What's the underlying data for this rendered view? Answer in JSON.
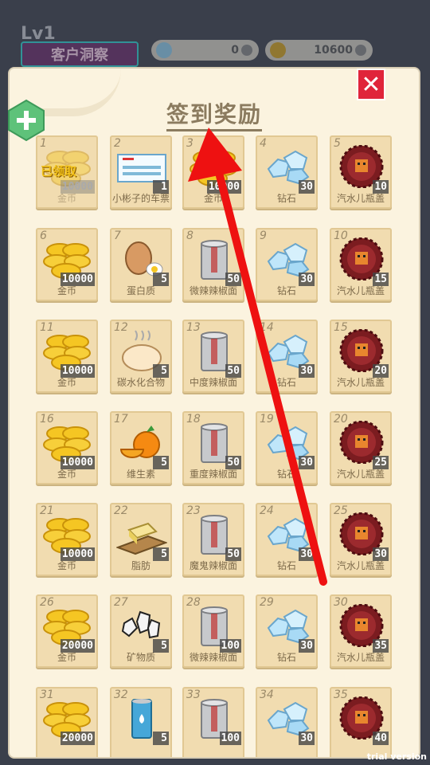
{
  "hud": {
    "level": "Lv1",
    "client_label": "客户洞察",
    "diamonds": "0",
    "coins": "10600"
  },
  "dialog": {
    "title": "签到奖励",
    "close_glyph": "✕"
  },
  "claimed_label": "已领取",
  "watermark": "trial version",
  "colors": {
    "panel": "#fbf3df",
    "cell": "#f1dcb0",
    "close": "#e0243a",
    "arrow": "#ee1111",
    "plus": "#5ec27a"
  },
  "rewards": [
    {
      "day": "1",
      "icon": "coin-icon",
      "qty": "10000",
      "name": "金币",
      "claimed": true
    },
    {
      "day": "2",
      "icon": "ticket-icon",
      "qty": "1",
      "name": "小彬子的车票"
    },
    {
      "day": "3",
      "icon": "coin-icon",
      "qty": "10000",
      "name": "金币"
    },
    {
      "day": "4",
      "icon": "diamond-icon",
      "qty": "30",
      "name": "钻石"
    },
    {
      "day": "5",
      "icon": "bottle-cap-icon",
      "qty": "10",
      "name": "汽水儿瓶盖"
    },
    {
      "day": "6",
      "icon": "coin-icon",
      "qty": "10000",
      "name": "金币"
    },
    {
      "day": "7",
      "icon": "egg-icon",
      "qty": "5",
      "name": "蛋白质"
    },
    {
      "day": "8",
      "icon": "noodle-can-icon",
      "qty": "50",
      "name": "微辣辣椒面"
    },
    {
      "day": "9",
      "icon": "diamond-icon",
      "qty": "30",
      "name": "钻石"
    },
    {
      "day": "10",
      "icon": "bottle-cap-icon",
      "qty": "15",
      "name": "汽水儿瓶盖"
    },
    {
      "day": "11",
      "icon": "coin-icon",
      "qty": "10000",
      "name": "金币"
    },
    {
      "day": "12",
      "icon": "bun-icon",
      "qty": "5",
      "name": "碳水化合物"
    },
    {
      "day": "13",
      "icon": "noodle-can-icon",
      "qty": "50",
      "name": "中度辣椒面"
    },
    {
      "day": "14",
      "icon": "diamond-icon",
      "qty": "30",
      "name": "钻石"
    },
    {
      "day": "15",
      "icon": "bottle-cap-icon",
      "qty": "20",
      "name": "汽水儿瓶盖"
    },
    {
      "day": "16",
      "icon": "coin-icon",
      "qty": "10000",
      "name": "金币"
    },
    {
      "day": "17",
      "icon": "orange-icon",
      "qty": "5",
      "name": "维生素"
    },
    {
      "day": "18",
      "icon": "noodle-can-icon",
      "qty": "50",
      "name": "重度辣椒面"
    },
    {
      "day": "19",
      "icon": "diamond-icon",
      "qty": "30",
      "name": "钻石"
    },
    {
      "day": "20",
      "icon": "bottle-cap-icon",
      "qty": "25",
      "name": "汽水儿瓶盖"
    },
    {
      "day": "21",
      "icon": "coin-icon",
      "qty": "10000",
      "name": "金币"
    },
    {
      "day": "22",
      "icon": "butter-icon",
      "qty": "5",
      "name": "脂肪"
    },
    {
      "day": "23",
      "icon": "noodle-can-icon",
      "qty": "50",
      "name": "魔鬼辣椒面"
    },
    {
      "day": "24",
      "icon": "diamond-icon",
      "qty": "30",
      "name": "钻石"
    },
    {
      "day": "25",
      "icon": "bottle-cap-icon",
      "qty": "30",
      "name": "汽水儿瓶盖"
    },
    {
      "day": "26",
      "icon": "coin-icon",
      "qty": "20000",
      "name": "金币"
    },
    {
      "day": "27",
      "icon": "mineral-icon",
      "qty": "5",
      "name": "矿物质"
    },
    {
      "day": "28",
      "icon": "noodle-can-icon",
      "qty": "100",
      "name": "微辣辣椒面"
    },
    {
      "day": "29",
      "icon": "diamond-icon",
      "qty": "30",
      "name": "钻石"
    },
    {
      "day": "30",
      "icon": "bottle-cap-icon",
      "qty": "35",
      "name": "汽水儿瓶盖"
    },
    {
      "day": "31",
      "icon": "coin-icon",
      "qty": "20000",
      "name": ""
    },
    {
      "day": "32",
      "icon": "water-can-icon",
      "qty": "5",
      "name": ""
    },
    {
      "day": "33",
      "icon": "noodle-can-icon",
      "qty": "100",
      "name": ""
    },
    {
      "day": "34",
      "icon": "diamond-icon",
      "qty": "30",
      "name": ""
    },
    {
      "day": "35",
      "icon": "bottle-cap-icon",
      "qty": "40",
      "name": ""
    }
  ]
}
